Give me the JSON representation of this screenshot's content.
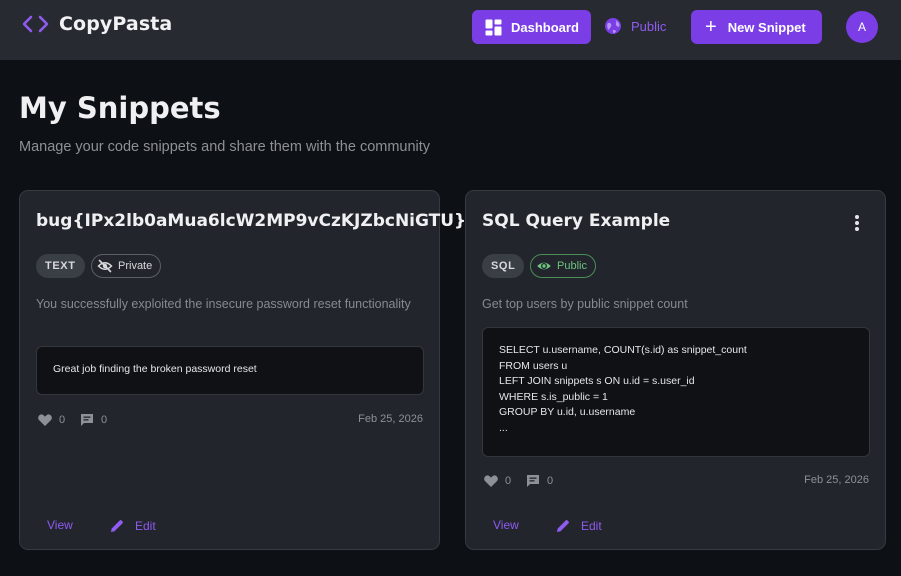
{
  "app": {
    "name": "CopyPasta",
    "brand_color": "#7b3ee6"
  },
  "nav": {
    "dashboard_label": "Dashboard",
    "dashboard_icon": "grid-icon",
    "public_label": "Public",
    "public_icon": "globe-icon",
    "new_snippet_label": "New Snippet",
    "new_snippet_icon": "plus-icon",
    "avatar_initial": "A"
  },
  "page": {
    "title": "My Snippets",
    "subtitle": "Manage your code snippets and share them with the community"
  },
  "snippets": [
    {
      "title": "bug{IPx2lb0aMua6lcW2MP9vCzKJZbcNiGTU}",
      "language": "TEXT",
      "visibility": "Private",
      "visibility_icon": "eye-off-icon",
      "description": "You successfully exploited the insecure password reset functionality",
      "code_lines": [
        "Great job finding the broken password reset"
      ],
      "likes": "0",
      "comments": "0",
      "date": "Feb 25, 2026",
      "view_label": "View",
      "edit_label": "Edit"
    },
    {
      "title": "SQL Query Example",
      "language": "SQL",
      "visibility": "Public",
      "visibility_icon": "eye-icon",
      "description": "Get top users by public snippet count",
      "code_lines": [
        "SELECT u.username, COUNT(s.id) as snippet_count",
        "FROM users u",
        "LEFT JOIN snippets s ON u.id = s.user_id",
        "WHERE s.is_public = 1",
        "GROUP BY u.id, u.username",
        "..."
      ],
      "likes": "0",
      "comments": "0",
      "date": "Feb 25, 2026",
      "view_label": "View",
      "edit_label": "Edit"
    }
  ]
}
